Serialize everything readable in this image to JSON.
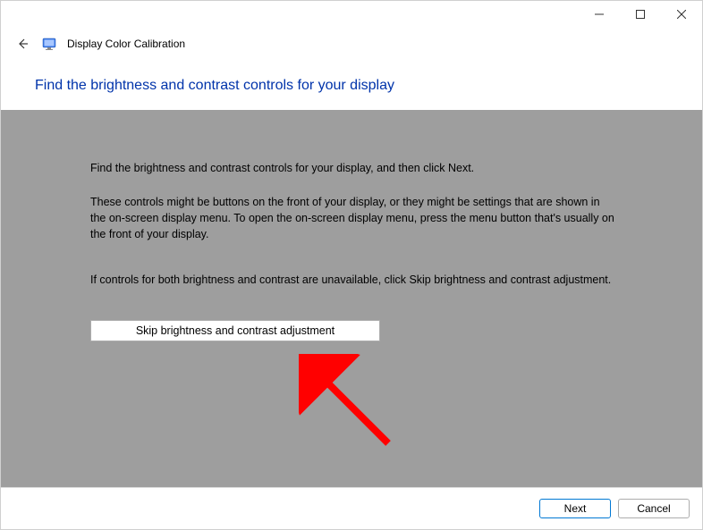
{
  "window": {
    "app_title": "Display Color Calibration"
  },
  "page": {
    "heading": "Find the brightness and contrast controls for your display"
  },
  "content": {
    "para1": "Find the brightness and contrast controls for your display, and then click Next.",
    "para2": "These controls might be buttons on the front of your display, or they might be settings that are shown in the on-screen display menu. To open the on-screen display menu, press the menu button that's usually on the front of your display.",
    "para3": "If controls for both brightness and contrast are unavailable, click Skip brightness and contrast adjustment.",
    "skip_button_label": "Skip brightness and contrast adjustment"
  },
  "footer": {
    "next_label": "Next",
    "cancel_label": "Cancel"
  }
}
